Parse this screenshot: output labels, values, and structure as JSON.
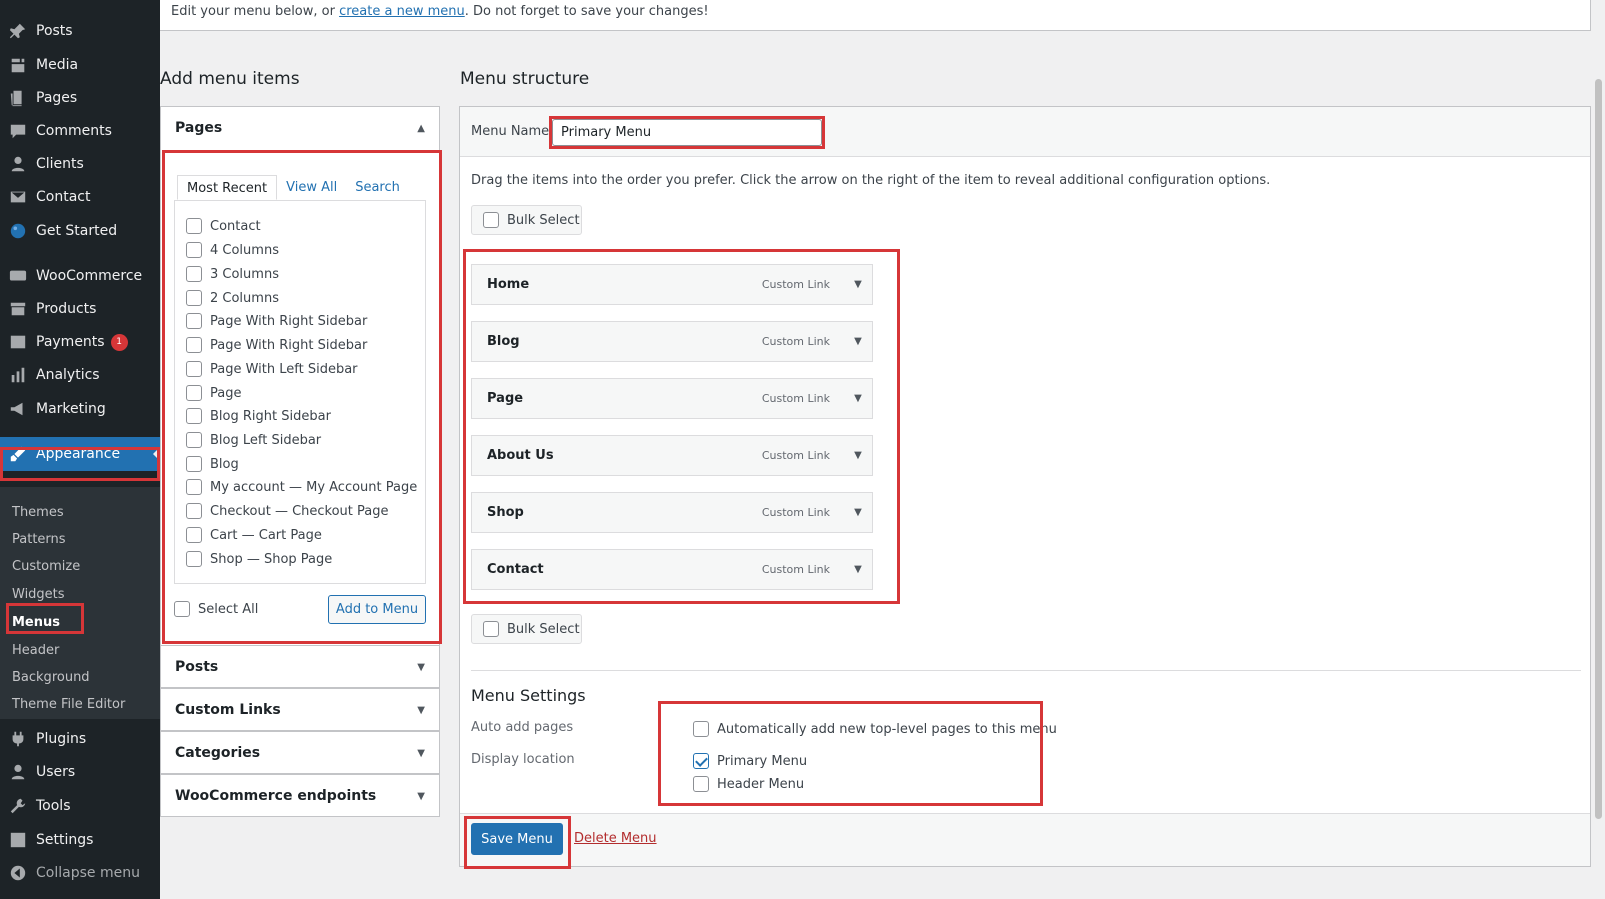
{
  "notice": {
    "before": "Edit your menu below, or ",
    "link": "create a new menu",
    "after": ". Do not forget to save your changes!"
  },
  "sidebar": {
    "items": [
      {
        "label": "Posts",
        "icon": "pin-icon"
      },
      {
        "label": "Media",
        "icon": "media-icon"
      },
      {
        "label": "Pages",
        "icon": "pages-icon"
      },
      {
        "label": "Comments",
        "icon": "comments-icon"
      },
      {
        "label": "Clients",
        "icon": "person-icon"
      },
      {
        "label": "Contact",
        "icon": "mail-icon"
      },
      {
        "label": "Get Started",
        "icon": "palette-icon"
      },
      {
        "label": "WooCommerce",
        "icon": "woo-icon"
      },
      {
        "label": "Products",
        "icon": "archive-icon"
      },
      {
        "label": "Payments",
        "icon": "dollar-icon",
        "badge": "1"
      },
      {
        "label": "Analytics",
        "icon": "bar-chart-icon"
      },
      {
        "label": "Marketing",
        "icon": "megaphone-icon"
      },
      {
        "label": "Appearance",
        "icon": "brush-icon"
      },
      {
        "label": "Plugins",
        "icon": "plug-icon"
      },
      {
        "label": "Users",
        "icon": "users-icon"
      },
      {
        "label": "Tools",
        "icon": "wrench-icon"
      },
      {
        "label": "Settings",
        "icon": "settings-icon"
      },
      {
        "label": "Collapse menu",
        "icon": "collapse-icon"
      }
    ],
    "submenu": [
      "Themes",
      "Patterns",
      "Customize",
      "Widgets",
      "Menus",
      "Header",
      "Background",
      "Theme File Editor"
    ]
  },
  "add_items": {
    "title": "Add menu items",
    "pages_section": "Pages",
    "tabs": [
      "Most Recent",
      "View All",
      "Search"
    ],
    "pages": [
      "Contact",
      "4 Columns",
      "3 Columns",
      "2 Columns",
      "Page With Right Sidebar",
      "Page With Right Sidebar",
      "Page With Left Sidebar",
      "Page",
      "Blog Right Sidebar",
      "Blog Left Sidebar",
      "Blog",
      "My account — My Account Page",
      "Checkout — Checkout Page",
      "Cart — Cart Page",
      "Shop — Shop Page"
    ],
    "select_all": "Select All",
    "add_button": "Add to Menu",
    "sections": [
      "Posts",
      "Custom Links",
      "Categories",
      "WooCommerce endpoints"
    ]
  },
  "structure": {
    "title": "Menu structure",
    "menu_name_label": "Menu Name",
    "menu_name_value": "Primary Menu",
    "instructions": "Drag the items into the order you prefer. Click the arrow on the right of the item to reveal additional configuration options.",
    "bulk_select": "Bulk Select",
    "items": [
      {
        "title": "Home",
        "type": "Custom Link"
      },
      {
        "title": "Blog",
        "type": "Custom Link"
      },
      {
        "title": "Page",
        "type": "Custom Link"
      },
      {
        "title": "About Us",
        "type": "Custom Link"
      },
      {
        "title": "Shop",
        "type": "Custom Link"
      },
      {
        "title": "Contact",
        "type": "Custom Link"
      }
    ],
    "settings": {
      "title": "Menu Settings",
      "auto_add_label": "Auto add pages",
      "auto_add_option": "Automatically add new top-level pages to this menu",
      "auto_add_checked": false,
      "display_location_label": "Display location",
      "locations": [
        {
          "label": "Primary Menu",
          "checked": true
        },
        {
          "label": "Header Menu",
          "checked": false
        }
      ]
    },
    "save_button": "Save Menu",
    "delete_link": "Delete Menu"
  },
  "colors": {
    "sidebar_bg": "#1d2327",
    "accent": "#2271b1",
    "highlight": "#d63638",
    "badge": "#d63638"
  }
}
